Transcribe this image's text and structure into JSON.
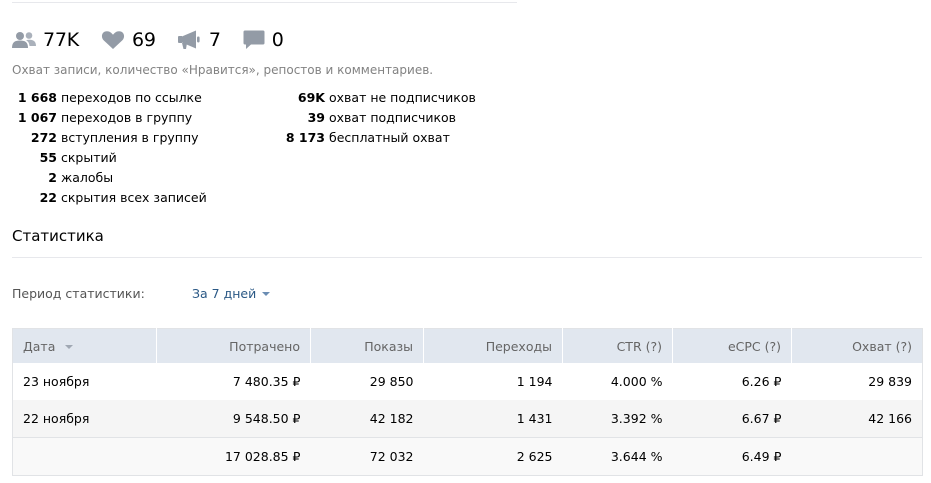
{
  "counters": {
    "subscribers": "77K",
    "likes": "69",
    "reposts": "7",
    "comments": "0"
  },
  "subtitle": "Охват записи, количество «Нравится», репостов и комментариев.",
  "stats_left": [
    {
      "value": "1 668",
      "label": "переходов по ссылке"
    },
    {
      "value": "1 067",
      "label": "переходов в группу"
    },
    {
      "value": "272",
      "label": "вступления в группу"
    },
    {
      "value": "55",
      "label": "скрытий"
    },
    {
      "value": "2",
      "label": "жалобы"
    },
    {
      "value": "22",
      "label": "скрытия всех записей"
    }
  ],
  "stats_right": [
    {
      "value": "69K",
      "label": "охват не подписчиков"
    },
    {
      "value": "39",
      "label": "охват подписчиков"
    },
    {
      "value": "8 173",
      "label": "бесплатный охват"
    }
  ],
  "section_title": "Статистика",
  "period": {
    "label": "Период статистики:",
    "value": "За 7 дней"
  },
  "table": {
    "headers": [
      "Дата",
      "Потрачено",
      "Показы",
      "Переходы",
      "CTR (?)",
      "eCPC (?)",
      "Охват (?)"
    ],
    "rows": [
      [
        "23 ноября",
        "7 480.35 ₽",
        "29 850",
        "1 194",
        "4.000 %",
        "6.26 ₽",
        "29 839"
      ],
      [
        "22 ноября",
        "9 548.50 ₽",
        "42 182",
        "1 431",
        "3.392 %",
        "6.67 ₽",
        "42 166"
      ]
    ],
    "total": [
      "",
      "17 028.85 ₽",
      "72 032",
      "2 625",
      "3.644 %",
      "6.49 ₽",
      ""
    ]
  },
  "colors": {
    "link": "#2a5885",
    "header_bg": "#e1e7ef",
    "icon": "#828a99"
  }
}
